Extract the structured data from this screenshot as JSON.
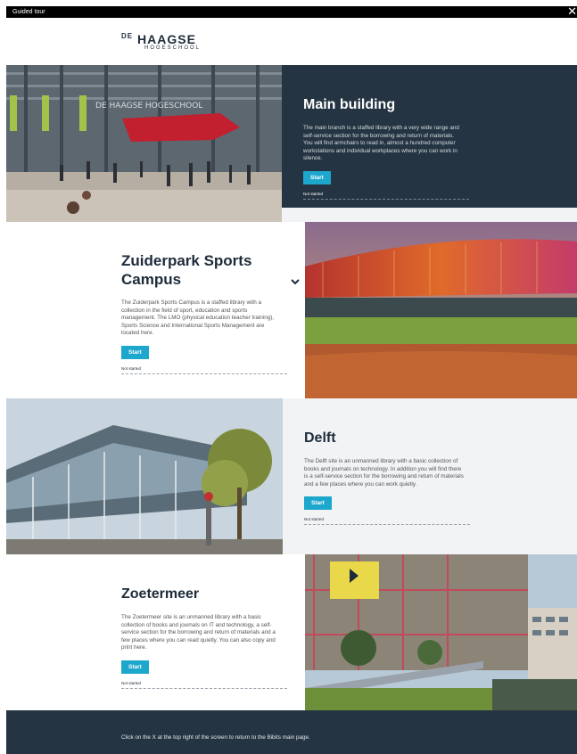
{
  "topbar": {
    "title": "Guided tour",
    "close_label": "✕"
  },
  "logo": {
    "prefix": "DE",
    "name": "HAAGSE",
    "sub": "HOGESCHOOL"
  },
  "locations": [
    {
      "title": "Main building",
      "description": "The main branch is a staffed library with a very wide range and self-service section for the borrowing and return of materials. You will find armchairs to read in, almost a hundred computer workstations and individual workplaces where you can work in silence.",
      "start_label": "Start",
      "status": "Not started",
      "photo_text": "DE HAAGSE HOGESCHOOL"
    },
    {
      "title": "Zuiderpark Sports Campus",
      "description": "The Zuiderpark Sports Campus is a staffed library with a collection in the field of sport, education and sports management. The LMO (physical education teacher training), Sports Science and International Sports Management are located here.",
      "start_label": "Start",
      "status": "Not started"
    },
    {
      "title": "Delft",
      "description": "The Delft site is an unmanned library with a basic collection of books and journals on technology. In addition you will find there is a self-service section for the borrowing and return of materials and a few places where you can work quietly.",
      "start_label": "Start",
      "status": "Not started"
    },
    {
      "title": "Zoetermeer",
      "description": "The Zoetermeer site is an unmanned library with a basic collection of books and journals on IT and technology, a self-service section for the borrowing and return of materials and a few places where you can read quietly. You can also copy and print here.",
      "start_label": "Start",
      "status": "Not started"
    }
  ],
  "footer": {
    "message": "Click on the X at the top right of the screen to return to the Bibits main page."
  },
  "colors": {
    "dark_navy": "#243442",
    "accent": "#1ea7cc",
    "light_grey": "#f2f3f5"
  }
}
